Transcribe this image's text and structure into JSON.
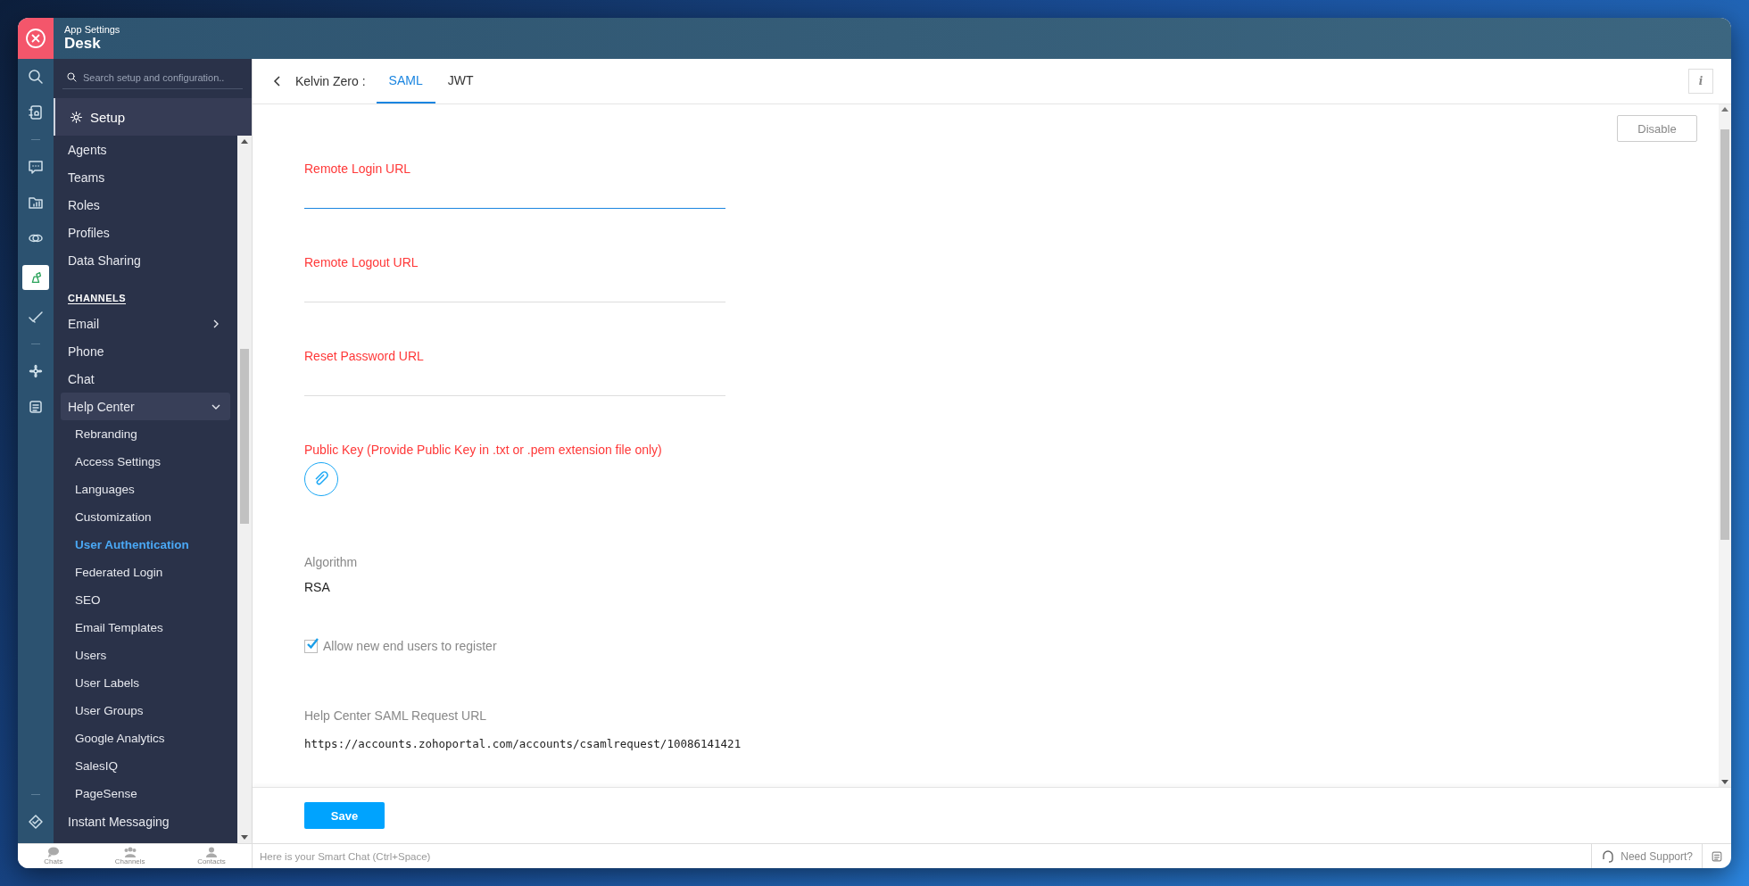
{
  "header": {
    "subtitle": "App Settings",
    "title": "Desk"
  },
  "sidebar": {
    "search_placeholder": "Search setup and configuration..",
    "setup_label": "Setup",
    "items": [
      {
        "label": "Agents",
        "kind": "item",
        "selected": false
      },
      {
        "label": "Teams",
        "kind": "item",
        "selected": false
      },
      {
        "label": "Roles",
        "kind": "item",
        "selected": false
      },
      {
        "label": "Profiles",
        "kind": "item",
        "selected": false
      },
      {
        "label": "Data Sharing",
        "kind": "item",
        "selected": false
      },
      {
        "label": "CHANNELS",
        "kind": "heading"
      },
      {
        "label": "Email",
        "kind": "item",
        "selected": false,
        "expanded": false
      },
      {
        "label": "Phone",
        "kind": "item",
        "selected": false
      },
      {
        "label": "Chat",
        "kind": "item",
        "selected": false
      },
      {
        "label": "Help Center",
        "kind": "item",
        "selected": false,
        "expanded": true,
        "children": [
          {
            "label": "Rebranding",
            "selected": false
          },
          {
            "label": "Access Settings",
            "selected": false
          },
          {
            "label": "Languages",
            "selected": false
          },
          {
            "label": "Customization",
            "selected": false
          },
          {
            "label": "User Authentication",
            "selected": true
          },
          {
            "label": "Federated Login",
            "selected": false
          },
          {
            "label": "SEO",
            "selected": false
          },
          {
            "label": "Email Templates",
            "selected": false
          },
          {
            "label": "Users",
            "selected": false
          },
          {
            "label": "User Labels",
            "selected": false
          },
          {
            "label": "User Groups",
            "selected": false
          },
          {
            "label": "Google Analytics",
            "selected": false
          },
          {
            "label": "SalesIQ",
            "selected": false
          },
          {
            "label": "PageSense",
            "selected": false
          }
        ]
      },
      {
        "label": "Instant Messaging",
        "kind": "item",
        "selected": false
      }
    ]
  },
  "page": {
    "title": "Kelvin Zero :",
    "tabs": [
      {
        "label": "SAML",
        "selected": true
      },
      {
        "label": "JWT",
        "selected": false
      }
    ],
    "disable_button": "Disable",
    "info_button": "i",
    "fields": [
      {
        "kind": "input",
        "label": "Remote Login URL",
        "focused": true
      },
      {
        "kind": "input",
        "label": "Remote Logout URL",
        "focused": false
      },
      {
        "kind": "input",
        "label": "Reset Password URL",
        "focused": false
      },
      {
        "kind": "file",
        "label": "Public Key (Provide Public Key in .txt or .pem extension file only)"
      },
      {
        "kind": "value",
        "label": "Algorithm",
        "value": "RSA"
      },
      {
        "kind": "checkbox",
        "label": "Allow new end users to register",
        "checked": true
      },
      {
        "kind": "url",
        "label": "Help Center SAML Request URL",
        "value": "https://accounts.zohoportal.com/accounts/csamlrequest/10086141421"
      }
    ],
    "save_button": "Save"
  },
  "bottom_bar": {
    "tabs": [
      "Chats",
      "Channels",
      "Contacts"
    ],
    "smart_chat_placeholder": "Here is your Smart Chat (Ctrl+Space)",
    "support": "Need Support?"
  }
}
